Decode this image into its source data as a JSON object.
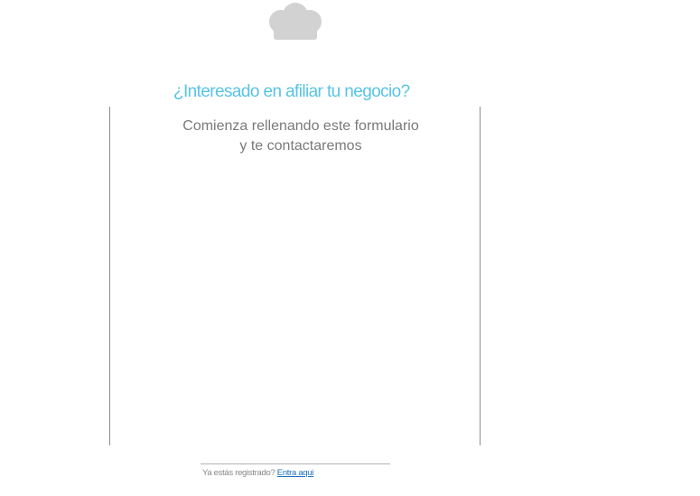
{
  "header": {
    "logo_icon": "chef-hat-icon",
    "logo_color": "#d2d2d2"
  },
  "main": {
    "title": "¿Interesado en afiliar tu negocio?",
    "subtitle_line1": "Comienza rellenando este formulario",
    "subtitle_line2": "y te contactaremos",
    "title_color": "#58c4e6",
    "subtitle_color": "#7a7a7a"
  },
  "footer": {
    "prompt": "Ya estás registrado?",
    "login_link": "Entra aqui",
    "link_color": "#1c6fb8"
  }
}
